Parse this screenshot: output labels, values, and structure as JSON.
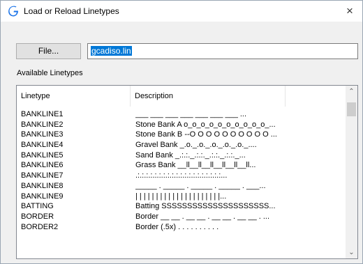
{
  "window": {
    "title": "Load or Reload Linetypes",
    "close_glyph": "×",
    "icon": "g-logo-icon",
    "accent": "#1a73e8"
  },
  "file": {
    "button_label": "File...",
    "value": "gcadiso.lin",
    "selection_color": "#0078d7"
  },
  "available_label": "Available Linetypes",
  "list": {
    "columns": [
      "Linetype",
      "Description"
    ],
    "rows": [
      {
        "name": "BANKLINE1",
        "desc": "___ ___ ___ ___ ___ ___ ___ ..."
      },
      {
        "name": "BANKLINE2",
        "desc": "Stone Bank A o_o_o_o_o_o_o_o_o_o_..."
      },
      {
        "name": "BANKLINE3",
        "desc": "Stone Bank B --O O O O O O O O O O ..."
      },
      {
        "name": "BANKLINE4",
        "desc": "Gravel Bank _.o._.o._.o._.o._.o._...."
      },
      {
        "name": "BANKLINE5",
        "desc": "Sand Bank _.:.:._.:.:._.:.:._.:.:._..."
      },
      {
        "name": "BANKLINE6",
        "desc": "Grass Bank __ll__ll__ll__ll__ll__ll..."
      },
      {
        "name": "BANKLINE7",
        "desc": ".:.:.:.:.:.:.:.:.:.:.:.:.:.:.:.:.:.:.:.:..."
      },
      {
        "name": "BANKLINE8",
        "desc": "_____ . _____ . _____ . _____ . ___..."
      },
      {
        "name": "BANKLINE9",
        "desc": "| | | | | | | | | | | | | | | | | | | | |..."
      },
      {
        "name": "BATTING",
        "desc": "Batting SSSSSSSSSSSSSSSSSSSSS..."
      },
      {
        "name": "BORDER",
        "desc": "Border __ __ . __ __ . __ __ . __ __ . ..."
      },
      {
        "name": "BORDER2",
        "desc": "Border (.5x) . . . . . . . . . ."
      }
    ]
  },
  "scrollbar": {
    "up_glyph": "⌃",
    "down_glyph": "⌄"
  }
}
